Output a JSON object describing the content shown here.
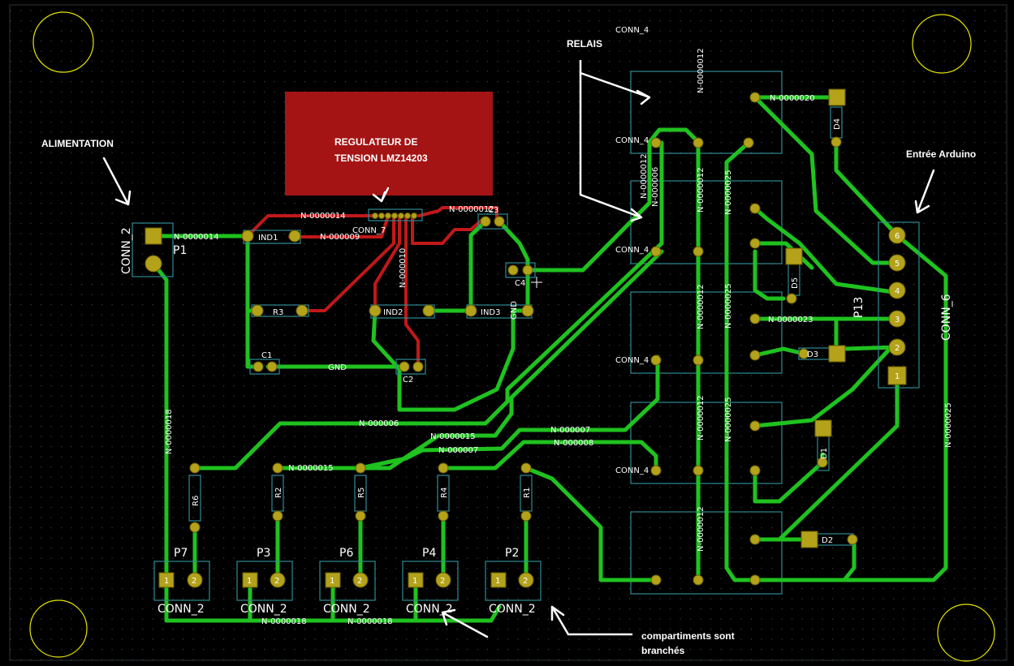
{
  "board": {
    "background": "#000000",
    "grid_dot_color": "#3a4046"
  },
  "colors": {
    "track_front": "#1fc21f",
    "track_back": "#c1181a",
    "pad": "#b3a21a",
    "outline": "#2f8a93",
    "annotation": "#ffffff",
    "mount_hole": "#e6e600"
  },
  "annotations": {
    "alimentation": "ALIMENTATION",
    "regulateur_line1": "REGULATEUR DE",
    "regulateur_line2": "TENSION LMZ14203",
    "relais": "RELAIS",
    "entree_arduino": "Entrée Arduino",
    "compartiments_line1": "compartiments sont",
    "compartiments_line2": "branchés"
  },
  "refs": {
    "conn2_left": "CONN_2",
    "p1": "P1",
    "conn7": "CONN_7",
    "p13": "P13",
    "conn6": "CONN_6",
    "p7": "P7",
    "p3": "P3",
    "p6": "P6",
    "p4": "P4",
    "p2": "P2",
    "conn2_bottom": [
      "CONN_2",
      "CONN_2",
      "CONN_2",
      "CONN_2",
      "CONN_2"
    ],
    "r3": "R3",
    "c1": "C1",
    "c2": "C2",
    "c3": "C3",
    "c4": "C4",
    "ind1": "IND1",
    "ind2": "IND2",
    "ind3": "IND3",
    "r6": "R6",
    "r2": "R2",
    "r5": "R5",
    "r4": "R4",
    "r1": "R1",
    "conn4": [
      "CONN_4",
      "CONN_4",
      "CONN_4",
      "CONN_4",
      "CONN_4"
    ],
    "diodes": [
      "D4",
      "D5",
      "D3",
      "D1",
      "D2"
    ]
  },
  "nets": {
    "n14_a": "N-0000014",
    "n14_b": "N-0000014",
    "n09": "N-000009",
    "n12_top": "N-0000012",
    "n10": "N-000010",
    "gnd_h": "GND",
    "gnd_v": "GND",
    "n18_v": "N-0000018",
    "n18_b1": "N-0000018",
    "n18_b2": "N-0000018",
    "n06_h": "N-000006",
    "n15_h": "N-0000015",
    "n15_r": "N-0000015",
    "n07_a": "N-000007",
    "n07_b": "N-000007",
    "n08": "N-000008",
    "n06_v": "N-000006",
    "n12_v1": "N-0000012",
    "n12_v2": "N-0000012",
    "n12_v3": "N-0000012",
    "n12_v4": "N-0000012",
    "n12_v5": "N-0000012",
    "n12_v6": "N-0000012",
    "n25_v1": "N-0000025",
    "n25_v2": "N-0000025",
    "n25_v3": "N-0000025",
    "n25_right": "N-0000025",
    "n20": "N-0000020",
    "n23": "N-0000023"
  },
  "pin_labels": {
    "p13": [
      "6",
      "5",
      "4",
      "3",
      "2",
      "1"
    ],
    "bottom": [
      "1",
      "2"
    ]
  }
}
